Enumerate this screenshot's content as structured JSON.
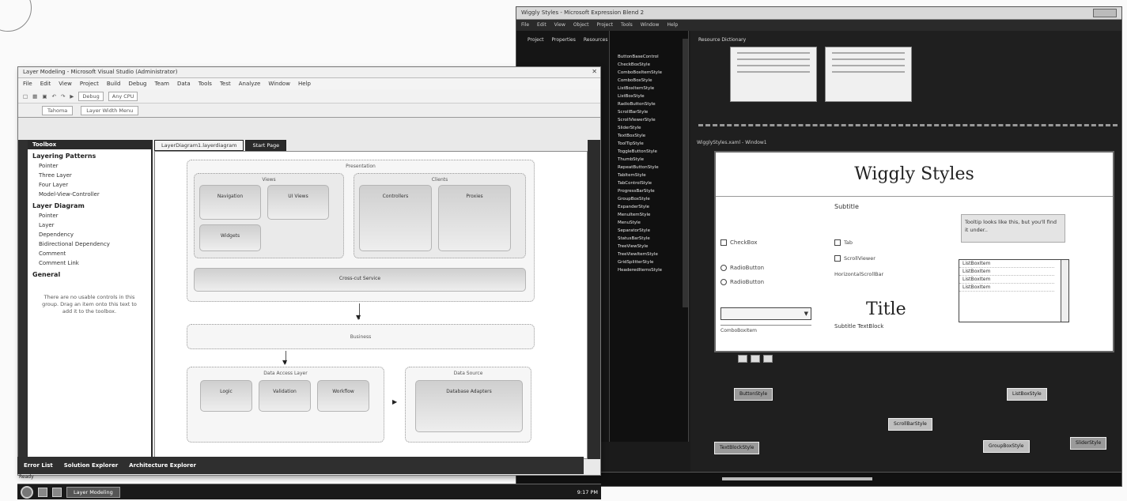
{
  "blend": {
    "title": "Wiggly Styles - Microsoft Expression Blend 2",
    "menu": [
      "File",
      "Edit",
      "View",
      "Object",
      "Project",
      "Tools",
      "Window",
      "Help"
    ],
    "left_tabs": [
      "Project",
      "Properties",
      "Resources"
    ],
    "resources_label": "Resource Dictionary",
    "tree_items": [
      "ButtonBaseControl",
      "CheckBoxStyle",
      "ComboBoxItemStyle",
      "ComboBoxStyle",
      "ListBoxItemStyle",
      "ListBoxStyle",
      "RadioButtonStyle",
      "ScrollBarStyle",
      "ScrollViewerStyle",
      "SliderStyle",
      "TextBoxStyle",
      "ToolTipStyle",
      "ToggleButtonStyle",
      "ThumbStyle",
      "RepeatButtonStyle",
      "TabItemStyle",
      "TabControlStyle",
      "ProgressBarStyle",
      "GroupBoxStyle",
      "ExpanderStyle",
      "MenuItemStyle",
      "MenuStyle",
      "SeparatorStyle",
      "StatusBarStyle",
      "TreeViewStyle",
      "TreeViewItemStyle",
      "GridSplitterStyle",
      "HeaderedItemsStyle"
    ],
    "artboard_label": "WigglyStyles.xaml - Window1",
    "artboard": {
      "title": "Wiggly Styles",
      "subtitle": "Subtitle",
      "tooltip": "Tooltip looks like this, but you'll find it under..",
      "checkbox1": "CheckBox",
      "checkbox2": "Tab",
      "radio1": "RadioButton",
      "radio2": "RadioButton",
      "scroll1": "ScrollViewer",
      "scroll2": "HorizontalScrollBar",
      "combo_item": "ComboBoxItem",
      "list_items": [
        "ListBoxItem",
        "ListBoxItem",
        "ListBoxItem",
        "ListBoxItem"
      ],
      "big_title": "Title",
      "big_subtitle": "Subtitle TextBlock"
    },
    "bottom_nodes": [
      "ButtonStyle",
      "ListBoxStyle",
      "ScrollBarStyle",
      "TextBlockStyle",
      "GroupBoxStyle",
      "SliderStyle"
    ]
  },
  "vs": {
    "title": "Layer Modeling - Microsoft Visual Studio (Administrator)",
    "menu": [
      "File",
      "Edit",
      "View",
      "Project",
      "Build",
      "Debug",
      "Team",
      "Data",
      "Tools",
      "Test",
      "Analyze",
      "Window",
      "Help"
    ],
    "toolbar": {
      "config": "Debug",
      "platform": "Any CPU"
    },
    "toolbar2": {
      "font": "Tahoma",
      "zoom": "Layer Width Menu"
    },
    "toolbox_title": "Toolbox",
    "toolbox": [
      {
        "group": "Layering Patterns",
        "items": [
          "Pointer",
          "Three Layer",
          "Four Layer",
          "Model-View-Controller"
        ]
      },
      {
        "group": "Layer Diagram",
        "items": [
          "Pointer",
          "Layer",
          "Dependency",
          "Bidirectional Dependency",
          "Comment",
          "Comment Link"
        ]
      },
      {
        "group": "General",
        "items": []
      }
    ],
    "toolbox_note": "There are no usable controls in this group. Drag an item onto this text to add it to the toolbox.",
    "doc_tabs": [
      "LayerDiagram1.layerdiagram",
      "Start Page"
    ],
    "diagram": {
      "presentation": "Presentation",
      "views": "Views",
      "clients": "Clients",
      "comp_a": "Navigation",
      "comp_b": "UI Views",
      "comp_c": "Widgets",
      "comp_d": "Controllers",
      "comp_e": "Proxies",
      "services": "Cross-cut Service",
      "business": "Business",
      "data_access": "Data Access Layer",
      "comp_f": "Logic",
      "comp_g": "Validation",
      "comp_h": "Workflow",
      "data_store": "Data Source",
      "comp_i": "Database Adapters"
    },
    "bottom_tabs": [
      "Error List",
      "Solution Explorer",
      "Architecture Explorer"
    ],
    "status": "Ready"
  },
  "taskbar": {
    "task_label": "Layer Modeling",
    "clock": "9:17 PM"
  }
}
